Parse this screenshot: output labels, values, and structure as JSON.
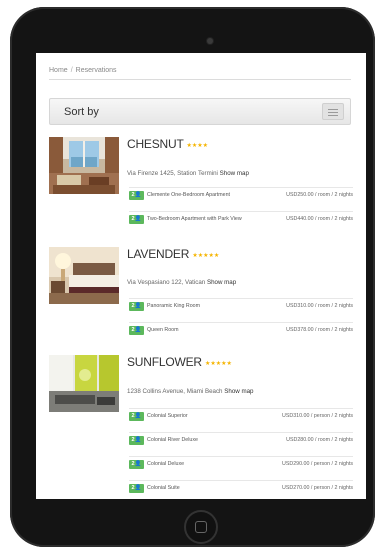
{
  "breadcrumb": {
    "home": "Home",
    "separator": "/",
    "current": "Reservations"
  },
  "sort": {
    "label": "Sort by"
  },
  "hotels": [
    {
      "name": "CHESNUT",
      "stars": "★★★★",
      "address": "Via Firenze 1425, Station Termini",
      "map_link": "Show map",
      "rooms": [
        {
          "badge": "2",
          "name": "Clemente One-Bedroom Apartment",
          "price": "USD250.00 / room / 2 nights"
        },
        {
          "badge": "2",
          "name": "Two-Bedroom Apartment with Park View",
          "price": "USD440.00 / room / 2 nights"
        }
      ]
    },
    {
      "name": "LAVENDER",
      "stars": "★★★★★",
      "address": "Via Vespasiano 122, Vatican",
      "map_link": "Show map",
      "rooms": [
        {
          "badge": "2",
          "name": "Panoramic King Room",
          "price": "USD310.00 / room / 2 nights"
        },
        {
          "badge": "2",
          "name": "Queen Room",
          "price": "USD378.00 / room / 2 nights"
        }
      ]
    },
    {
      "name": "SUNFLOWER",
      "stars": "★★★★★",
      "address": "1238 Collins Avenue, Miami Beach",
      "map_link": "Show map",
      "rooms": [
        {
          "badge": "2",
          "name": "Colonial Superior",
          "price": "USD310.00 / person / 2 nights"
        },
        {
          "badge": "2",
          "name": "Colonial River Deluxe",
          "price": "USD280.00 / room / 2 nights"
        },
        {
          "badge": "2",
          "name": "Colonial Deluxe",
          "price": "USD290.00 / person / 2 nights"
        },
        {
          "badge": "2",
          "name": "Colonial Suite",
          "price": "USD270.00 / person / 2 nights"
        }
      ]
    }
  ],
  "colors": {
    "accent": "#5cb85c",
    "stars": "#f5b400",
    "device": "#141414"
  }
}
